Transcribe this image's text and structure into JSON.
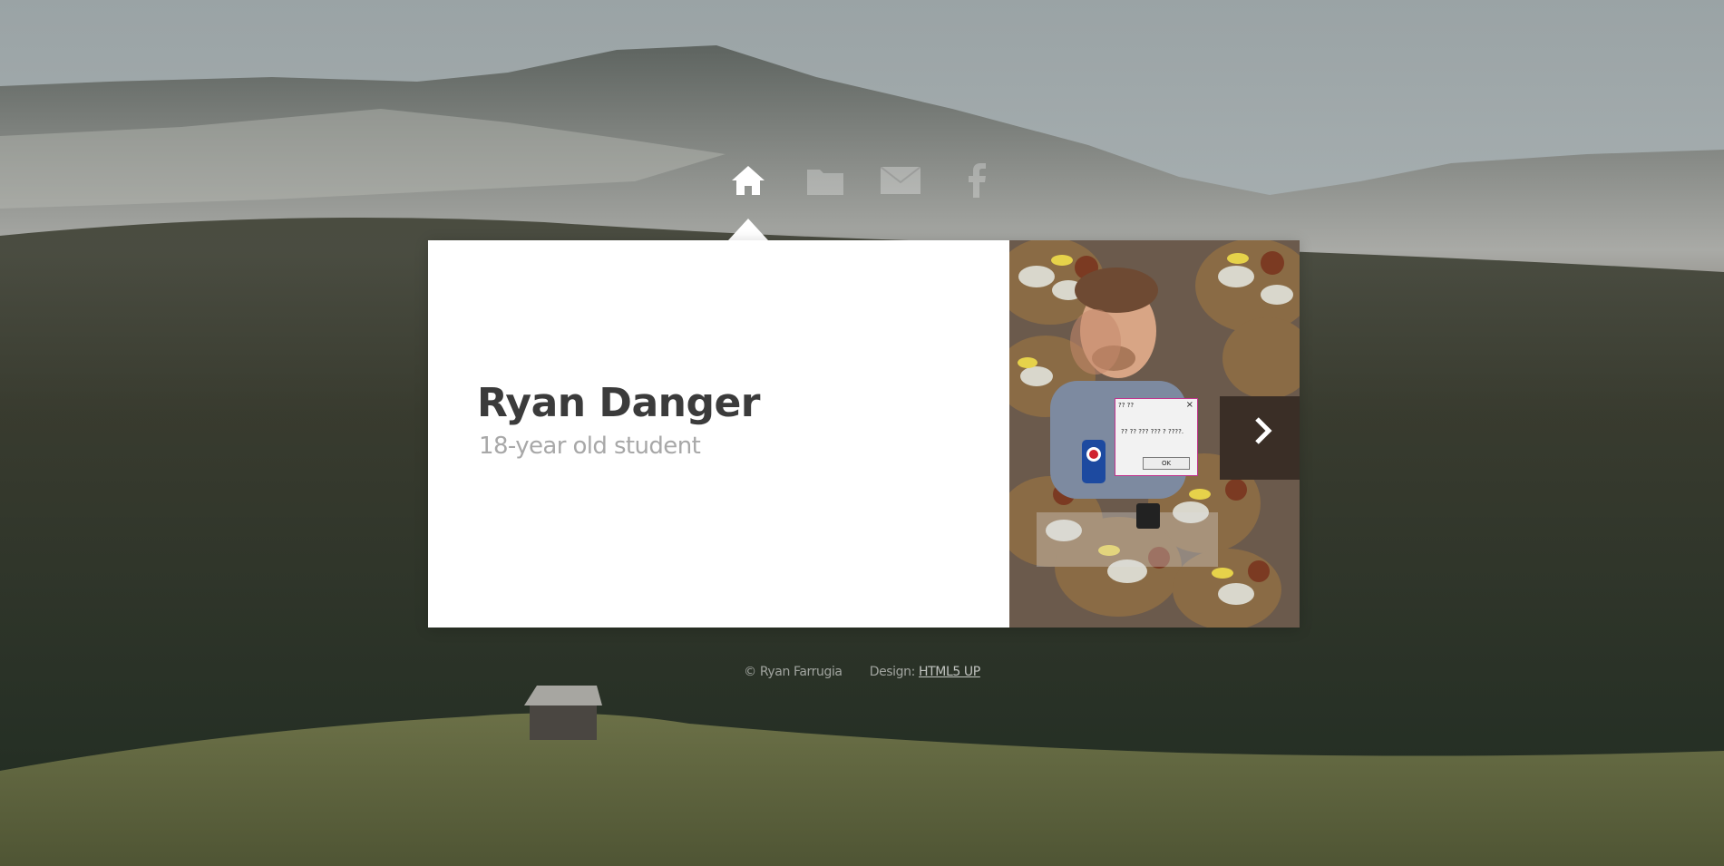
{
  "nav": {
    "items": [
      {
        "id": "home",
        "icon": "home-icon",
        "active": true
      },
      {
        "id": "portfolio",
        "icon": "folder-icon",
        "active": false
      },
      {
        "id": "contact",
        "icon": "envelope-icon",
        "active": false
      },
      {
        "id": "facebook",
        "icon": "facebook-icon",
        "active": false
      }
    ]
  },
  "profile": {
    "name": "Ryan Danger",
    "subtitle": "18-year old student"
  },
  "photo_dialog": {
    "title": "?? ??",
    "close": "×",
    "message": "?? ?? ??? ??? ? ????.",
    "ok_label": "OK"
  },
  "footer": {
    "copyright": "© Ryan Farrugia",
    "design_prefix": "Design:",
    "design_link": "HTML5 UP"
  },
  "colors": {
    "panel_bg": "#ffffff",
    "name_text": "#3b3b3b",
    "subtitle_text": "#a8a8a8",
    "dialog_border": "#c2348e"
  }
}
